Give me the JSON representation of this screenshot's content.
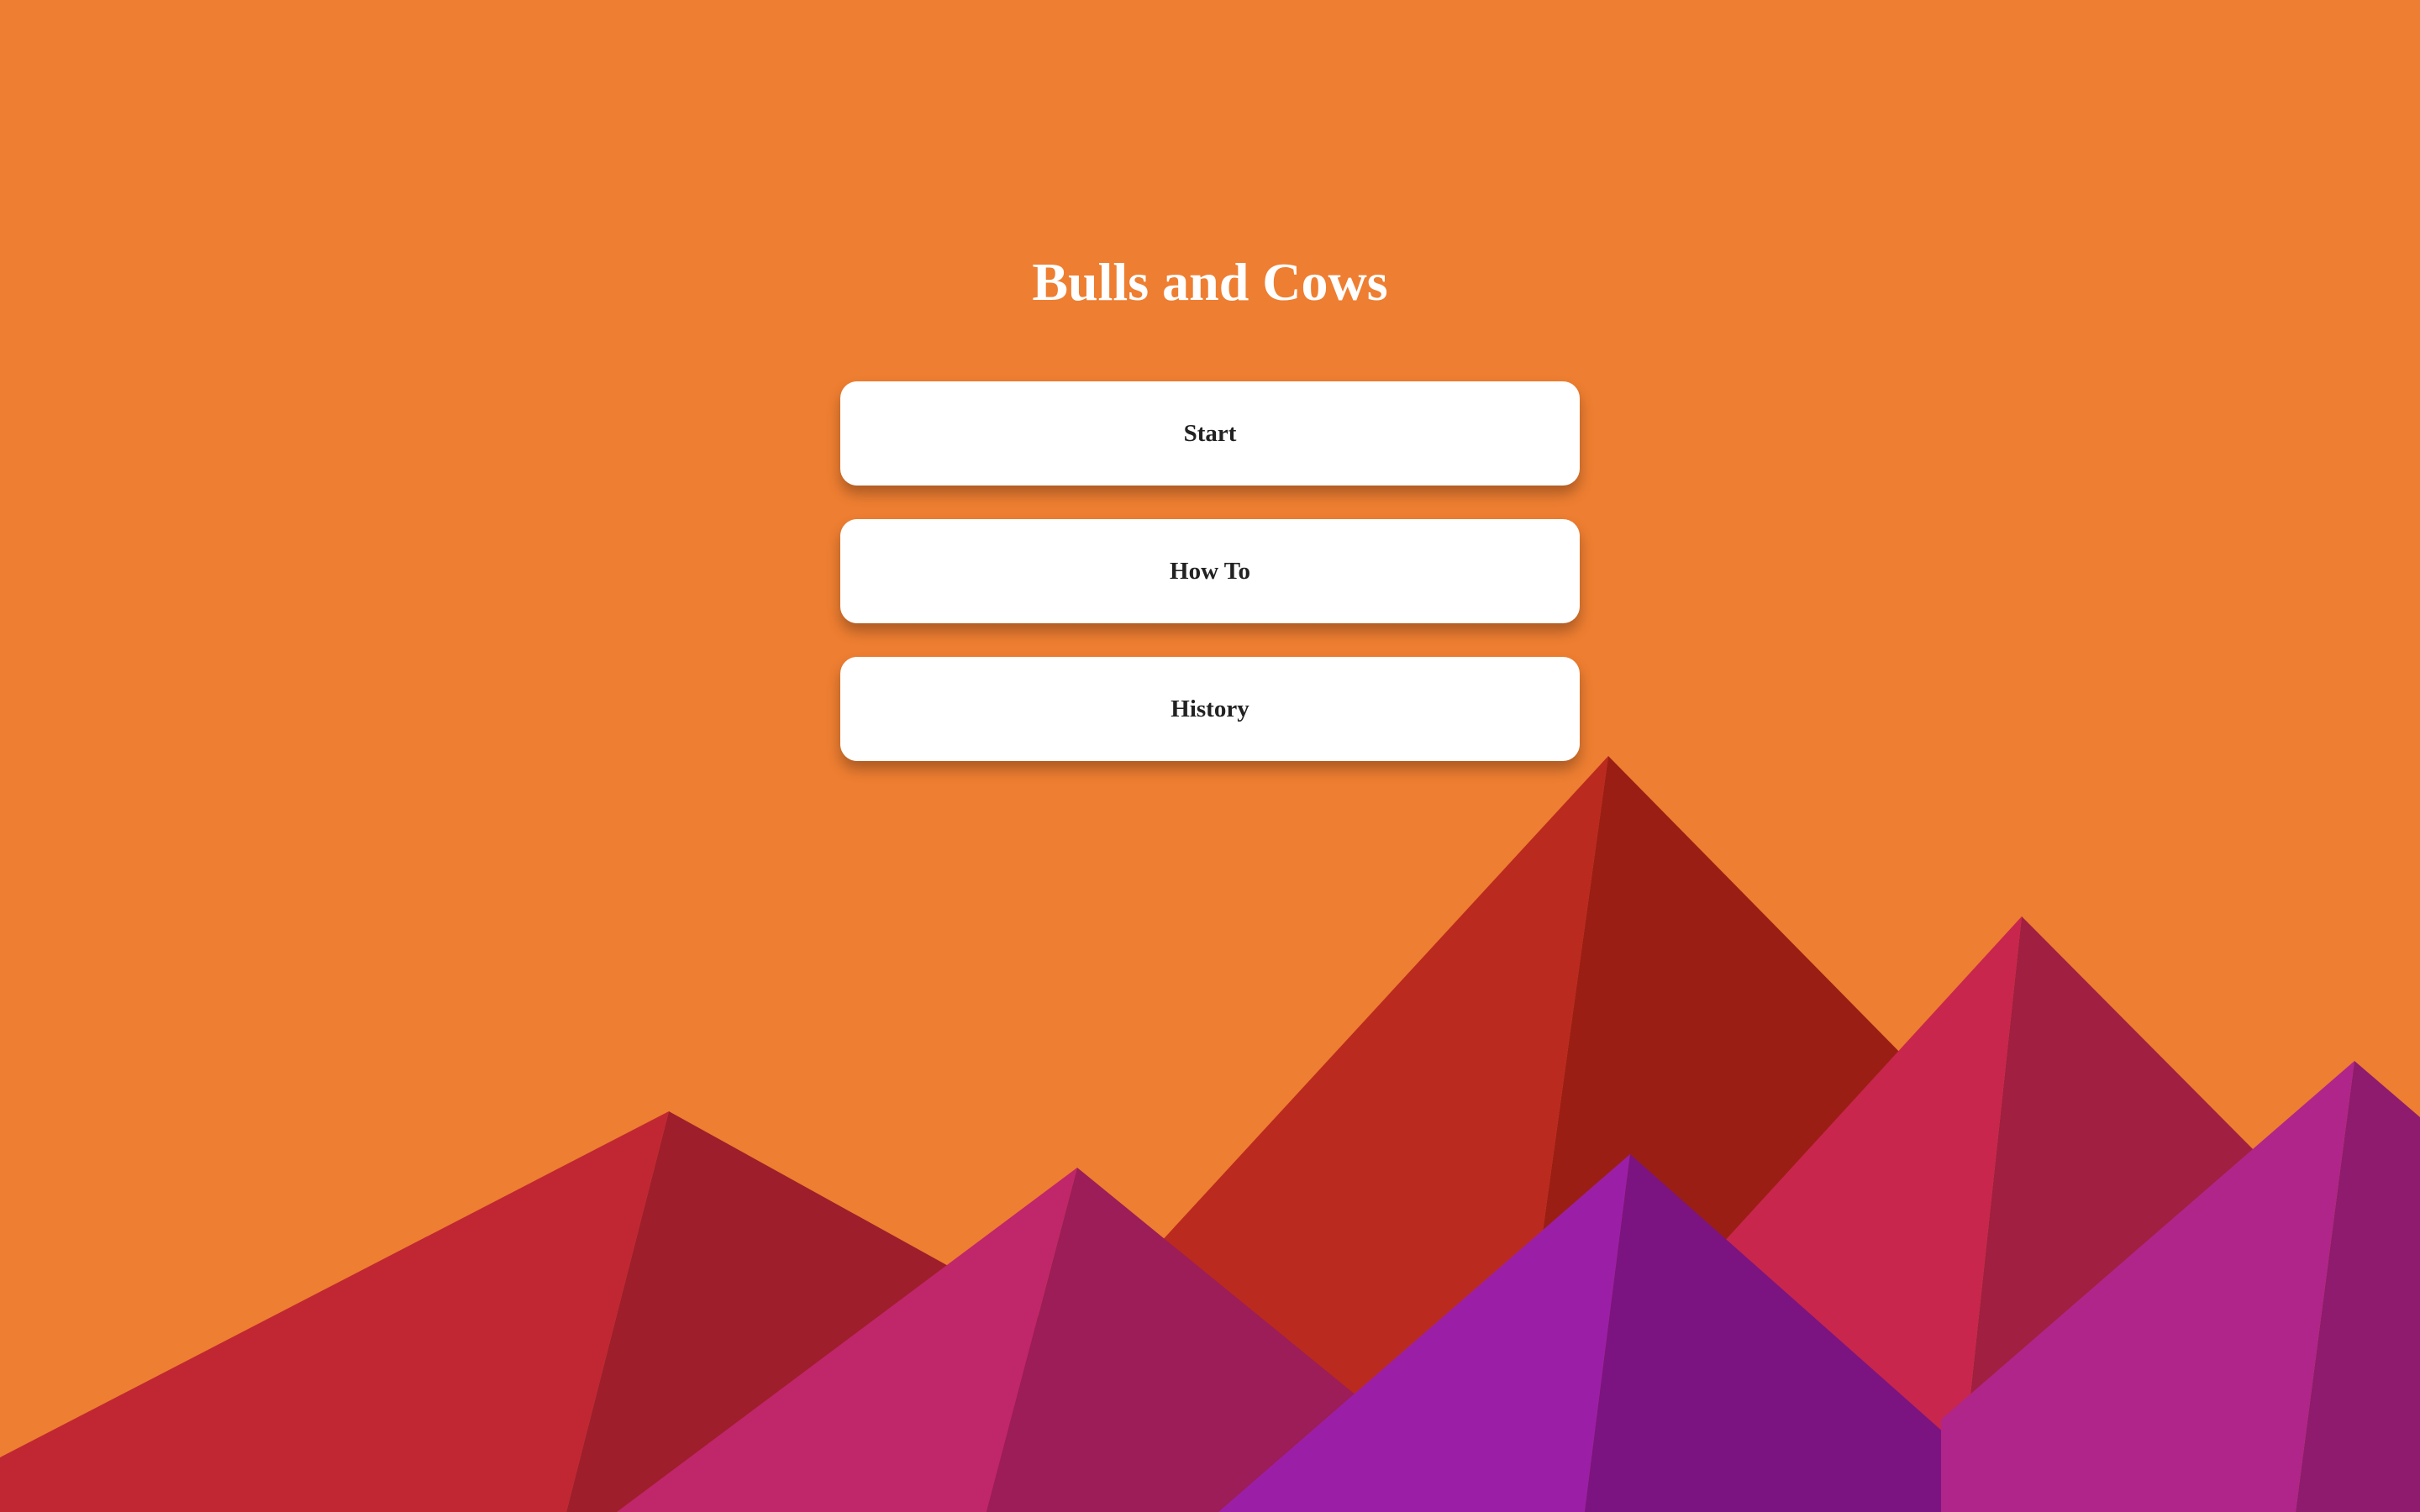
{
  "game": {
    "title": "Bulls and Cows"
  },
  "menu": {
    "buttons": [
      {
        "label": "Start"
      },
      {
        "label": "How To"
      },
      {
        "label": "History"
      }
    ]
  },
  "colors": {
    "background": "#ee7e31",
    "button": "#ffffff",
    "title_text": "#ffffff",
    "button_text": "#222222",
    "mountains": [
      "#c12733",
      "#9e1e2b",
      "#bb2a1e",
      "#9b1e15",
      "#c8264d",
      "#a11f40",
      "#c0266a",
      "#9c1d57",
      "#9b1fa6",
      "#7b1480",
      "#b02589",
      "#8e1b6e"
    ]
  }
}
